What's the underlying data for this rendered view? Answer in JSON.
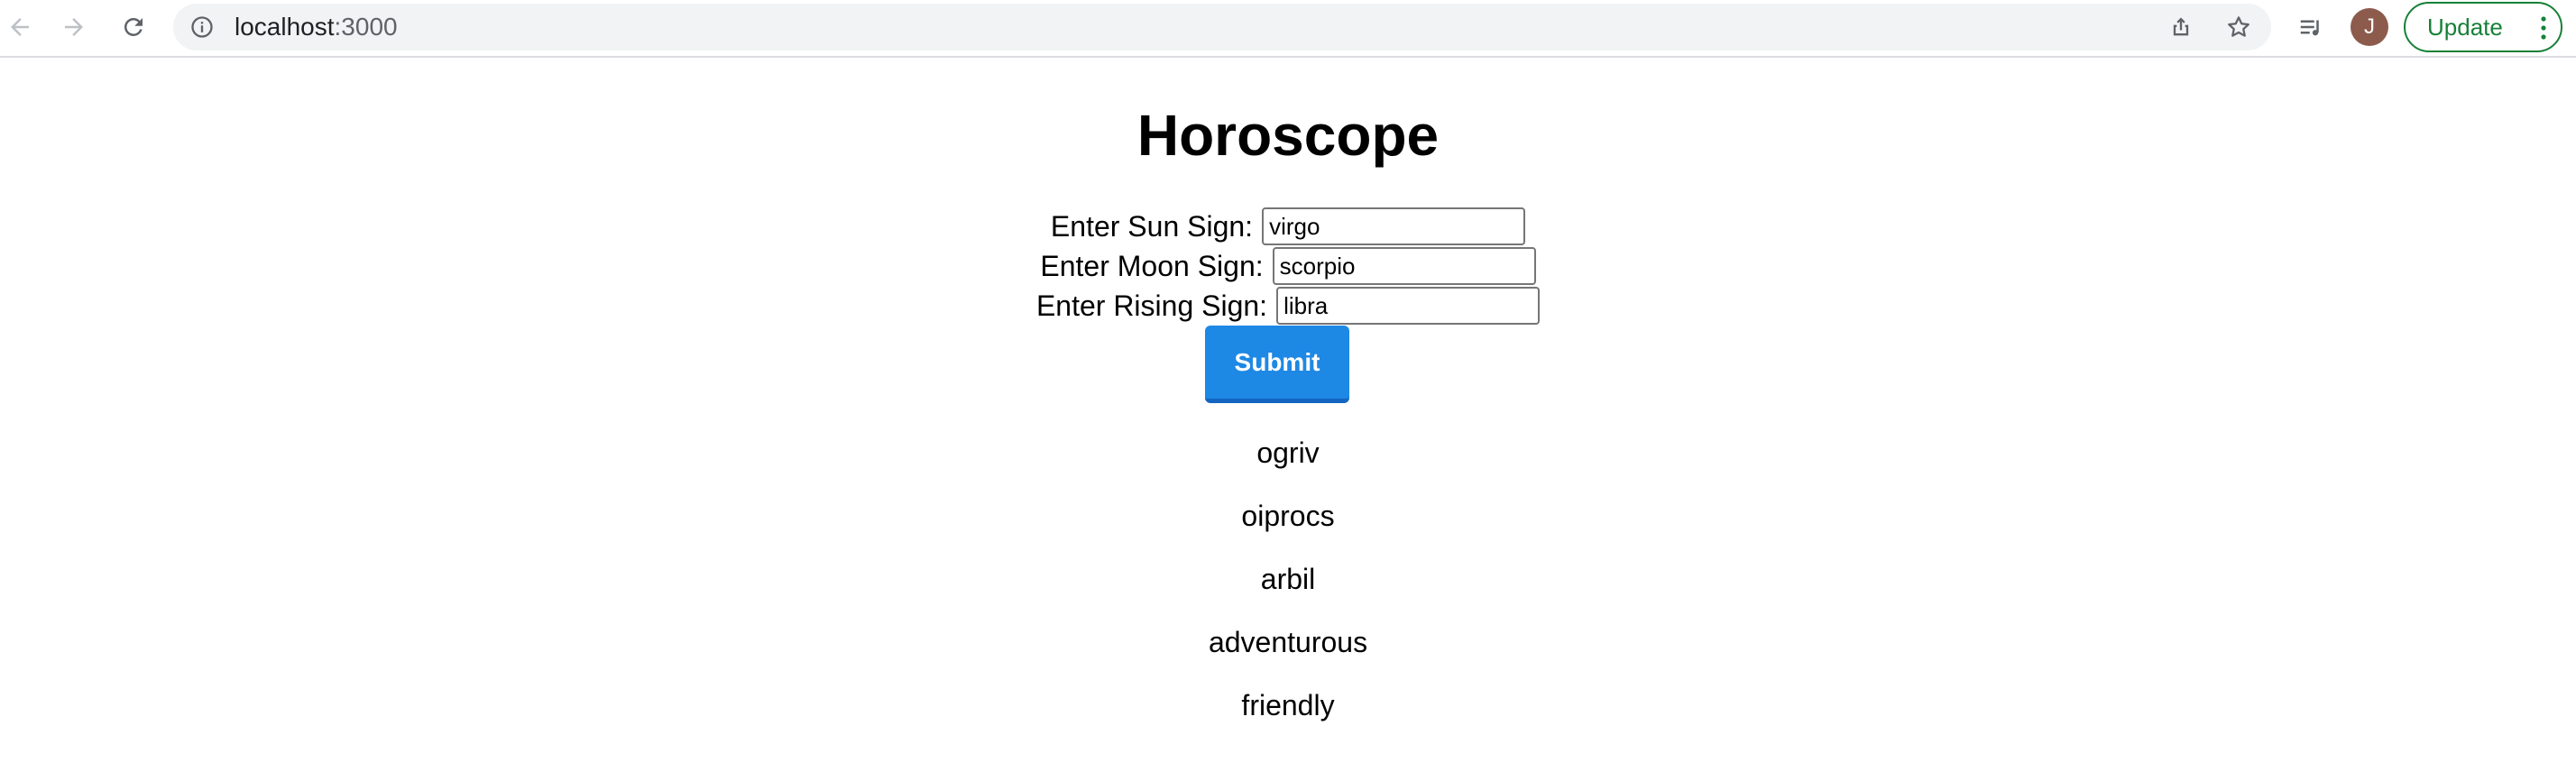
{
  "browser": {
    "url_host": "localhost",
    "url_port": ":3000",
    "profile_initial": "J",
    "update_label": "Update",
    "icons": {
      "back": "back-arrow-icon",
      "forward": "forward-arrow-icon",
      "reload": "reload-icon",
      "site_info": "info-icon",
      "share": "share-icon",
      "bookmark": "star-icon",
      "reading_list": "media-queue-icon",
      "menu": "kebab-menu-icon"
    },
    "update_color": "#188038"
  },
  "page": {
    "title": "Horoscope",
    "form": {
      "sun": {
        "label": "Enter Sun Sign:",
        "value": "virgo"
      },
      "moon": {
        "label": "Enter Moon Sign:",
        "value": "scorpio"
      },
      "rising": {
        "label": "Enter Rising Sign:",
        "value": "libra"
      },
      "submit_label": "Submit",
      "submit_color": "#1e88e5"
    },
    "results": [
      "ogriv",
      "oiprocs",
      "arbil",
      "adventurous",
      "friendly"
    ]
  }
}
